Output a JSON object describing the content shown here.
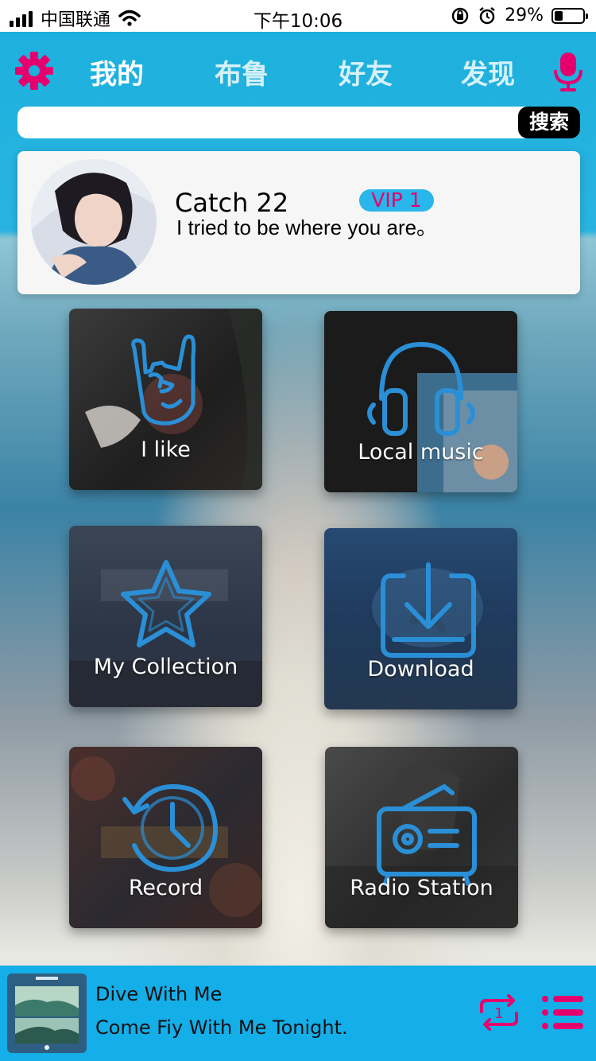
{
  "status": {
    "carrier": "中国联通",
    "time": "下午10:06",
    "battery": "29%",
    "battery_level": 0.29
  },
  "nav": {
    "tabs": [
      {
        "label": "我的",
        "active": true
      },
      {
        "label": "布鲁",
        "active": false
      },
      {
        "label": "好友",
        "active": false
      },
      {
        "label": "发现",
        "active": false
      }
    ],
    "accent": "#e5006e"
  },
  "search": {
    "button_label": "搜索",
    "value": ""
  },
  "profile": {
    "name": "Catch 22",
    "vip": "VIP 1",
    "motto": "I tried to be where you are。"
  },
  "tiles": [
    {
      "label": "I like",
      "icon": "rock-hand-icon"
    },
    {
      "label": "Local music",
      "icon": "headphones-icon"
    },
    {
      "label": "My Collection",
      "icon": "star-icon"
    },
    {
      "label": "Download",
      "icon": "download-icon"
    },
    {
      "label": "Record",
      "icon": "history-clock-icon"
    },
    {
      "label": "Radio Station",
      "icon": "radio-icon"
    }
  ],
  "player": {
    "title": "Dive With Me",
    "subtitle": "Come Fiy With Me Tonight.",
    "loop_count": "1"
  },
  "colors": {
    "header_blue": "#1bb0dd",
    "icon_blue": "#2a8fd6",
    "pink": "#e5006e"
  }
}
